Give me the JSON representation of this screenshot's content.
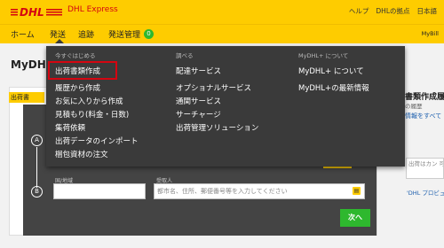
{
  "header": {
    "logo_text": "DHL",
    "product_name": "DHL Express",
    "links": [
      "ヘルプ",
      "DHLの拠点",
      "日本語"
    ],
    "brand_red": "#d40511",
    "brand_yellow": "#fecc00"
  },
  "nav": {
    "items": [
      "ホーム",
      "発送",
      "追跡",
      "発送管理"
    ],
    "badge": "0",
    "right_label": "MyBill"
  },
  "page": {
    "title": "MyDHL",
    "panel_tab": "出荷書",
    "steps": [
      "A",
      "B"
    ],
    "country_label": "国/地域",
    "recipient_label": "受取人",
    "recipient_placeholder": "都市名、住所、郵便番号等を入力してください",
    "next_button": "次へ",
    "next_color": "#2eb82e"
  },
  "sidebar": {
    "title": "書類作成履",
    "subtitle": "の履歴",
    "link": "情報をすべて",
    "note": "出荷はカン 可能にする 送信",
    "link2": "'DHL プロビュー'"
  },
  "mega_menu": {
    "columns": [
      {
        "heading": "今すぐはじめる",
        "items": [
          "出荷書類作成",
          "履歴から作成",
          "お気に入りから作成",
          "見積もり(料金・日数)",
          "集荷依頼",
          "出荷データのインポート",
          "梱包資材の注文"
        ]
      },
      {
        "heading": "調べる",
        "items": [
          "配達サービス",
          "オプショナルサービス",
          "通関サービス",
          "サーチャージ",
          "出荷管理ソリューション"
        ]
      },
      {
        "heading": "MyDHL+ について",
        "items": [
          "MyDHL+ について",
          "MyDHL+の最新情報"
        ]
      }
    ],
    "highlighted_item": "出荷書類作成"
  }
}
